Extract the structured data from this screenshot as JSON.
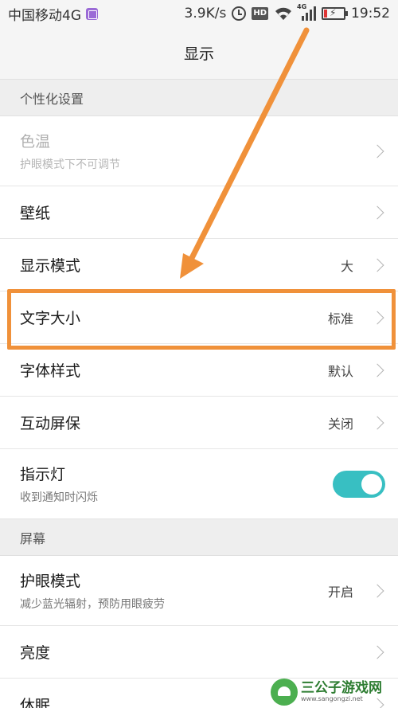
{
  "status_bar": {
    "carrier": "中国移动4G",
    "speed": "3.9K/s",
    "network_tag": "4G",
    "hd_label": "HD",
    "time": "19:52",
    "icons": [
      "gallery-icon",
      "alarm-icon",
      "hd-icon",
      "wifi-icon",
      "signal-icon",
      "battery-charging-icon"
    ]
  },
  "header": {
    "title": "显示"
  },
  "sections": [
    {
      "header": "个性化设置",
      "rows": [
        {
          "title": "色温",
          "subtitle": "护眼模式下不可调节",
          "value": "",
          "disabled": true
        },
        {
          "title": "壁纸",
          "subtitle": "",
          "value": ""
        },
        {
          "title": "显示模式",
          "subtitle": "",
          "value": "大"
        },
        {
          "title": "文字大小",
          "subtitle": "",
          "value": "标准",
          "highlighted": true
        },
        {
          "title": "字体样式",
          "subtitle": "",
          "value": "默认"
        },
        {
          "title": "互动屏保",
          "subtitle": "",
          "value": "关闭"
        },
        {
          "title": "指示灯",
          "subtitle": "收到通知时闪烁",
          "toggle": true,
          "toggle_on": true
        }
      ]
    },
    {
      "header": "屏幕",
      "rows": [
        {
          "title": "护眼模式",
          "subtitle": "减少蓝光辐射，预防用眼疲劳",
          "value": "开启"
        },
        {
          "title": "亮度",
          "subtitle": "",
          "value": ""
        },
        {
          "title": "休眠",
          "subtitle": "",
          "value": ""
        }
      ]
    }
  ],
  "annotation": {
    "color": "#f0913a"
  },
  "watermark": {
    "title": "三公子游戏网",
    "url": "www.sangongzi.net"
  },
  "colors": {
    "toggle_on": "#38bfc2",
    "background": "#f7f7f7",
    "section_bg": "#eeeeee"
  }
}
